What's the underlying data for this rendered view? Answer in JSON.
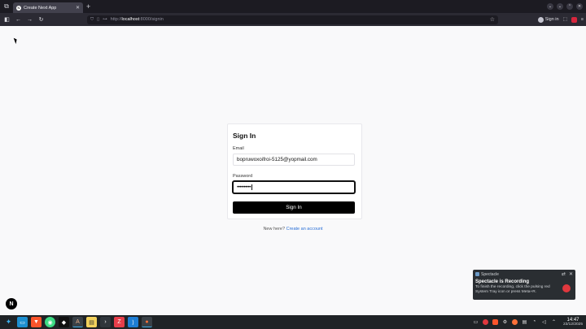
{
  "browser": {
    "tab_title": "Create Next App",
    "tab_favicon": "N",
    "url_scheme": "http://",
    "url_host": "localhost",
    "url_path": ":8000/signin",
    "signin_label": "Sign in"
  },
  "signin_form": {
    "heading": "Sign In",
    "email_label": "Email",
    "email_value": "bopruwoxoifroi-5125@yopmail.com",
    "password_label": "Password",
    "password_value": "••••••••••",
    "submit_label": "Sign In"
  },
  "footer": {
    "prompt": "New here?",
    "create_account_link": "Create an account"
  },
  "next_badge": "N",
  "notification": {
    "app_name": "Spectacle",
    "title": "Spectacle is Recording",
    "message": "To finish the recording, click the pulsing red System Tray icon or press Meta+R."
  },
  "taskbar": {
    "time": "14:47",
    "date": "23/12/2025"
  },
  "colors": {
    "accent_link": "#2a6fd6",
    "primary_button": "#000000",
    "record_red": "#e0383e"
  }
}
